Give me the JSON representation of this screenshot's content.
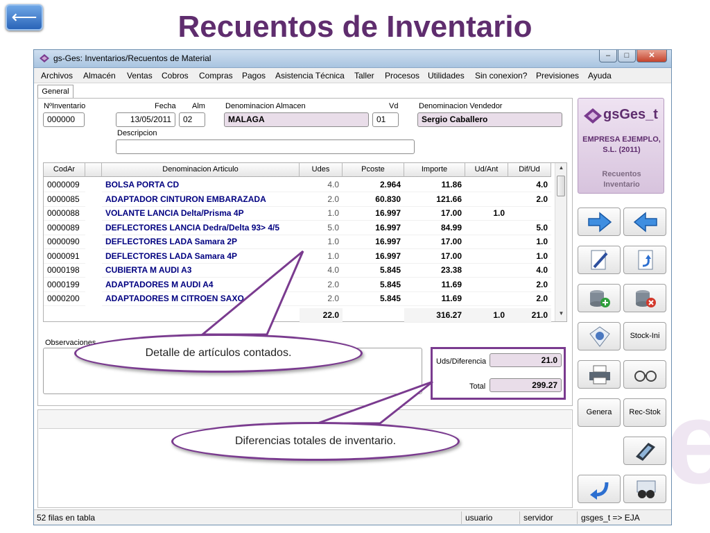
{
  "slide": {
    "title": "Recuentos de Inventario",
    "back_glyph": "⟵"
  },
  "window": {
    "title": "gs-Ges: Inventarios/Recuentos de Material",
    "controls": [
      "–",
      "□",
      "✕"
    ]
  },
  "menu": [
    "Archivos",
    "Almacén",
    "Ventas",
    "Cobros",
    "Compras",
    "Pagos",
    "Asistencia Técnica",
    "Taller",
    "Procesos",
    "Utilidades",
    "Sin conexion?",
    "Previsiones",
    "Ayuda"
  ],
  "tab": "General",
  "form": {
    "n_inventario": {
      "label": "NºInventario",
      "value": "000000"
    },
    "fecha": {
      "label": "Fecha",
      "value": "13/05/2011"
    },
    "alm": {
      "label": "Alm",
      "value": "02"
    },
    "denominacion_almacen": {
      "label": "Denominacion Almacen",
      "value": "MALAGA"
    },
    "vd": {
      "label": "Vd",
      "value": "01"
    },
    "denominacion_vendedor": {
      "label": "Denominacion Vendedor",
      "value": "Sergio Caballero"
    },
    "descripcion": {
      "label": "Descripcion",
      "value": ""
    }
  },
  "grid": {
    "columns": [
      "CodAr",
      "",
      "Denominacion Articulo",
      "Udes",
      "Pcoste",
      "Importe",
      "Ud/Ant",
      "Dif/Ud"
    ],
    "rows": [
      [
        "0000009",
        "BOLSA PORTA CD",
        "4.0",
        "2.964",
        "11.86",
        "",
        "4.0"
      ],
      [
        "0000085",
        "ADAPTADOR CINTURON EMBARAZADA",
        "2.0",
        "60.830",
        "121.66",
        "",
        "2.0"
      ],
      [
        "0000088",
        "VOLANTE LANCIA Delta/Prisma 4P",
        "1.0",
        "16.997",
        "17.00",
        "1.0",
        ""
      ],
      [
        "0000089",
        "DEFLECTORES LANCIA Dedra/Delta 93> 4/5",
        "5.0",
        "16.997",
        "84.99",
        "",
        "5.0"
      ],
      [
        "0000090",
        "DEFLECTORES LADA Samara 2P",
        "1.0",
        "16.997",
        "17.00",
        "",
        "1.0"
      ],
      [
        "0000091",
        "DEFLECTORES LADA Samara 4P",
        "1.0",
        "16.997",
        "17.00",
        "",
        "1.0"
      ],
      [
        "0000198",
        "CUBIERTA M AUDI A3",
        "4.0",
        "5.845",
        "23.38",
        "",
        "4.0"
      ],
      [
        "0000199",
        "ADAPTADORES M AUDI A4",
        "2.0",
        "5.845",
        "11.69",
        "",
        "2.0"
      ],
      [
        "0000200",
        "ADAPTADORES M CITROEN SAXO",
        "2.0",
        "5.845",
        "11.69",
        "",
        "2.0"
      ]
    ],
    "totals": {
      "udes": "22.0",
      "importe": "316.27",
      "ud_ant": "1.0",
      "dif_ud": "21.0"
    }
  },
  "observaciones": {
    "label": "Observaciones"
  },
  "summary": {
    "uds_diferencia": {
      "label": "Uds/Diferencia",
      "value": "21.0"
    },
    "total": {
      "label": "Total",
      "value": "299.27"
    }
  },
  "status": {
    "rows": "52 filas en tabla",
    "user": "usuario",
    "server": "servidor",
    "session": "gsges_t => EJA"
  },
  "logo": {
    "brand": "gsGes_t",
    "company_line1": "EMPRESA EJEMPLO,",
    "company_line2": "S.L. (2011)",
    "module_line1": "Recuentos",
    "module_line2": "Inventario"
  },
  "buttons": {
    "next": "arrow-right-icon",
    "prev": "arrow-left-icon",
    "edit": "edit-document-icon",
    "undo": "undo-document-icon",
    "add": "database-add-icon",
    "delete": "database-delete-icon",
    "view": "view-document-icon",
    "stock_ini": "Stock-Ini",
    "print": "printer-icon",
    "preview": "glasses-icon",
    "genera": "Genera",
    "rec_stok": "Rec-Stok",
    "calculator": "calculator-icon",
    "exit": "exit-arrow-icon",
    "search": "binoculars-icon"
  },
  "callouts": {
    "detail": "Detalle de artículos contados.",
    "differences": "Diferencias totales de inventario."
  },
  "colors": {
    "accent": "#7a3b8f",
    "title": "#5f2d6e",
    "readonly_field": "#e9dde9"
  }
}
